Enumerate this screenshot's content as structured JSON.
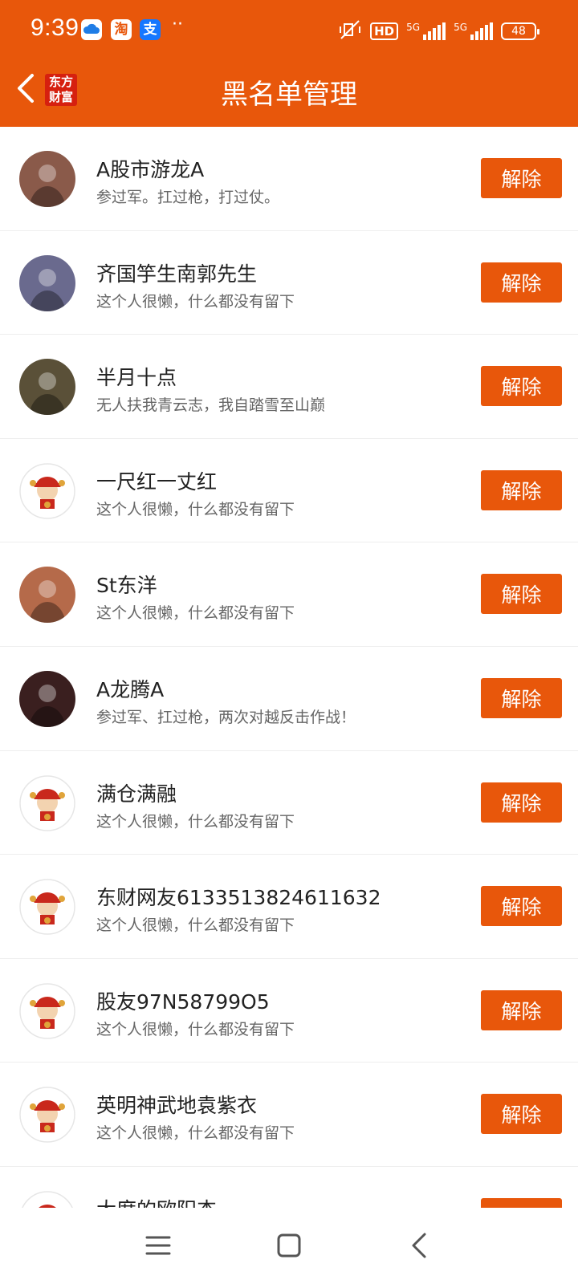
{
  "status_bar": {
    "time": "9:39",
    "app_icons": [
      "cloud-icon",
      "taobao-icon",
      "alipay-icon"
    ],
    "taobao_glyph": "淘",
    "alipay_glyph": "支",
    "dots": "··",
    "hd_label": "HD",
    "network_1": "5G",
    "network_2": "5G",
    "battery": "48"
  },
  "header": {
    "title": "黑名单管理",
    "logo_line1": "东方",
    "logo_line2": "财富",
    "accent_color": "#e8570b"
  },
  "blacklist": {
    "unblock_label": "解除",
    "items": [
      {
        "name": "A股市游龙A",
        "bio": " 参过军。扛过枪，打过仗。",
        "avatar": "photo"
      },
      {
        "name": "齐国竽生南郭先生",
        "bio": "这个人很懒，什么都没有留下",
        "avatar": "photo"
      },
      {
        "name": "半月十点",
        "bio": "无人扶我青云志，我自踏雪至山巅",
        "avatar": "photo"
      },
      {
        "name": "一尺红一丈红",
        "bio": "这个人很懒，什么都没有留下",
        "avatar": "default"
      },
      {
        "name": "St东洋",
        "bio": "这个人很懒，什么都没有留下",
        "avatar": "photo"
      },
      {
        "name": "A龙腾A",
        "bio": "参过军、扛过枪，两次对越反击作战！",
        "avatar": "photo"
      },
      {
        "name": "满仓满融",
        "bio": "这个人很懒，什么都没有留下",
        "avatar": "default"
      },
      {
        "name": "东财网友6133513824611632",
        "bio": "这个人很懒，什么都没有留下",
        "avatar": "default"
      },
      {
        "name": "股友97N58799O5",
        "bio": "这个人很懒，什么都没有留下",
        "avatar": "default"
      },
      {
        "name": "英明神武地袁紫衣",
        "bio": "这个人很懒，什么都没有留下",
        "avatar": "default"
      },
      {
        "name": "大度的欧阳杰",
        "bio": "",
        "avatar": "default"
      }
    ]
  },
  "bottom_nav": {
    "icons": [
      "menu-icon",
      "home-icon",
      "back-icon"
    ]
  }
}
